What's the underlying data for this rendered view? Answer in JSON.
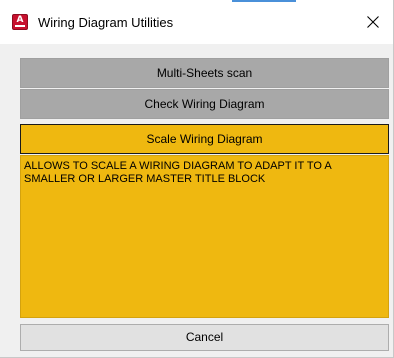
{
  "window": {
    "title": "Wiring Diagram Utilities",
    "app_icon": "autocad-icon"
  },
  "buttons": {
    "multi_sheets": "Multi-Sheets scan",
    "check_wiring": "Check Wiring Diagram",
    "scale_wiring": "Scale Wiring Diagram"
  },
  "description": "ALLOWS TO SCALE A WIRING DIAGRAM TO ADAPT IT TO A SMALLER OR LARGER MASTER TITLE BLOCK",
  "footer": {
    "cancel_label": "Cancel"
  },
  "colors": {
    "active": "#efb810",
    "inactive": "#a8a8a8",
    "icon": "#c8102e"
  }
}
